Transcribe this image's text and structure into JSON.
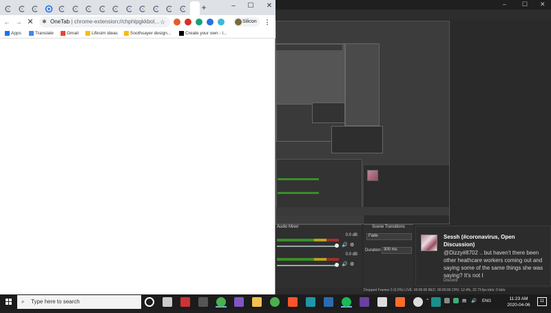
{
  "chrome": {
    "tabs": [
      {
        "icon": "onetab-icon"
      },
      {
        "icon": "onetab-icon"
      },
      {
        "icon": "onetab-icon"
      },
      {
        "icon": "blue-circle-icon"
      },
      {
        "icon": "onetab-icon"
      },
      {
        "icon": "onetab-icon"
      },
      {
        "icon": "onetab-icon"
      },
      {
        "icon": "onetab-icon"
      },
      {
        "icon": "onetab-icon"
      },
      {
        "icon": "onetab-icon"
      },
      {
        "icon": "onetab-icon"
      },
      {
        "icon": "onetab-icon"
      },
      {
        "icon": "onetab-icon"
      },
      {
        "icon": "onetab-icon"
      }
    ],
    "new_tab_label": "+",
    "window_controls": {
      "minimize": "–",
      "maximize": "☐",
      "close": "✕"
    },
    "url_site": "OneTab",
    "url_rest": "chrome-extension://chphlpgkkbol...",
    "profile_name": "Silicon",
    "bookmarks": [
      {
        "label": "Apps",
        "icon": "apps-grid-icon"
      },
      {
        "label": "Translate",
        "icon": "translate-icon"
      },
      {
        "label": "Gmail",
        "icon": "gmail-icon"
      },
      {
        "label": "Lifesim ideas",
        "icon": "drive-icon"
      },
      {
        "label": "Soothsayer design...",
        "icon": "drive-icon"
      },
      {
        "label": "Create your own - l...",
        "icon": "bookmark-black-icon"
      }
    ]
  },
  "obs": {
    "mixer_title": "Audio Mixer",
    "channels": [
      {
        "db": "0.0 dB"
      },
      {
        "db": "0.0 dB"
      }
    ],
    "transitions_title": "Scene Transitions",
    "transition": "Fade",
    "duration_label": "Duration",
    "duration_value": "300 ms",
    "status": "Dropped Frames 0 (0.0%)   LIVE: 00:00:00   REC: 00:00:00   CPU: 12.4%, 22.73 fps   kb/s: 0 kb/s"
  },
  "notification": {
    "title": "Sessh (#coronavirus, Open Discussion)",
    "body": "@Dizzy#8702 .. but haven't there been other heathcare workers coming out and saying some of the same things she was saying? It's not I",
    "source": "Discord"
  },
  "taskbar": {
    "search_placeholder": "Type here to search",
    "apps": [
      {
        "icon": "cortana-icon"
      },
      {
        "icon": "task-view-icon"
      },
      {
        "icon": "app-red-icon"
      },
      {
        "icon": "app-dark-icon"
      },
      {
        "icon": "chrome-icon"
      },
      {
        "icon": "visual-studio-icon"
      },
      {
        "icon": "file-explorer-icon"
      },
      {
        "icon": "chrome-icon"
      },
      {
        "icon": "brave-icon"
      },
      {
        "icon": "app-s-icon"
      },
      {
        "icon": "app-w-icon"
      },
      {
        "icon": "spotify-icon"
      },
      {
        "icon": "app-purple-icon"
      },
      {
        "icon": "photos-icon"
      },
      {
        "icon": "app-orange-icon"
      },
      {
        "icon": "obs-icon"
      },
      {
        "icon": "app-teal-icon"
      }
    ],
    "language": "ENG",
    "time": "11:23 AM",
    "date": "2020-04-06",
    "notification_count": "11"
  }
}
